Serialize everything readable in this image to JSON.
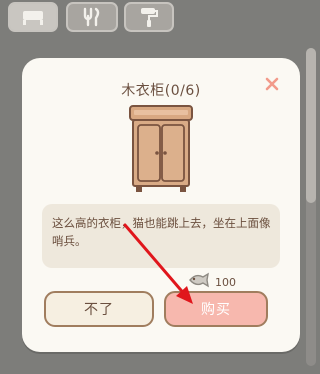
{
  "tabs": [
    {
      "icon": "furniture-icon",
      "active": true
    },
    {
      "icon": "utensils-icon",
      "active": false
    },
    {
      "icon": "paint-roller-icon",
      "active": false
    }
  ],
  "dialog": {
    "title": "木衣柜(0/6)",
    "close_icon": "close-icon",
    "item_image": "wardrobe-image",
    "description": "这么高的衣柜，猫也能跳上去，坐在上面像哨兵。",
    "price": {
      "icon": "fish-icon",
      "value": "100"
    },
    "cancel_label": "不了",
    "buy_label": "购买"
  },
  "colors": {
    "overlay": "#7d7d7a",
    "dialog_bg": "#fbf9f3",
    "text_brown": "#6b5040",
    "buy_button": "#f7b8ae",
    "cancel_button": "#f6efe1",
    "close_icon": "#f29a8a",
    "annotation_arrow": "#e0161c"
  }
}
